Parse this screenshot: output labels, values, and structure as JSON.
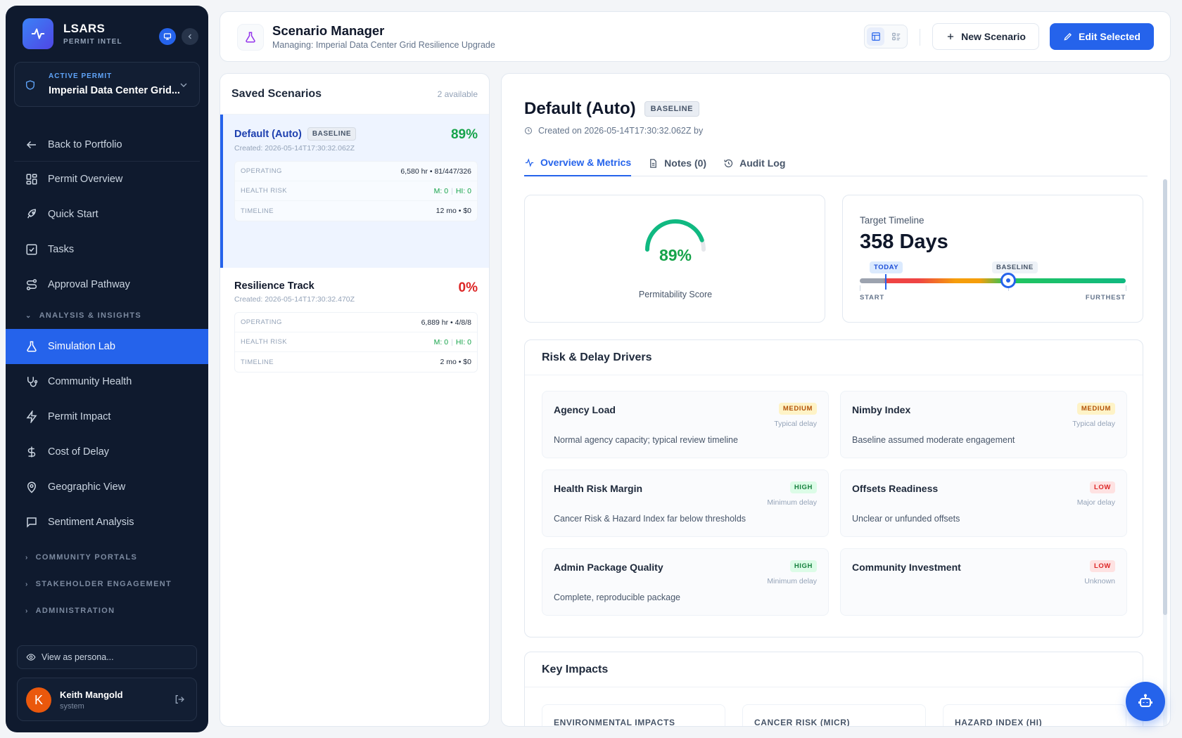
{
  "brand": {
    "name": "LSARS",
    "sub": "PERMIT INTEL"
  },
  "permit": {
    "label": "ACTIVE PERMIT",
    "name": "Imperial Data Center Grid..."
  },
  "nav": {
    "back": "Back to Portfolio",
    "items": [
      "Permit Overview",
      "Quick Start",
      "Tasks",
      "Approval Pathway"
    ],
    "section_analysis": "ANALYSIS & INSIGHTS",
    "analysis_items": [
      "Simulation Lab",
      "Community Health",
      "Permit Impact",
      "Cost of Delay",
      "Geographic View",
      "Sentiment Analysis"
    ],
    "section_portals": "COMMUNITY PORTALS",
    "section_stakeholder": "STAKEHOLDER ENGAGEMENT",
    "section_admin": "ADMINISTRATION"
  },
  "persona": {
    "label": "View as persona..."
  },
  "user": {
    "initial": "K",
    "name": "Keith Mangold",
    "role": "system"
  },
  "header": {
    "title": "Scenario Manager",
    "subtitle": "Managing: Imperial Data Center Grid Resilience Upgrade",
    "new_label": "New Scenario",
    "edit_label": "Edit Selected"
  },
  "saved": {
    "title": "Saved Scenarios",
    "count": "2 available",
    "scenarios": [
      {
        "name": "Default (Auto)",
        "badge": "BASELINE",
        "created": "Created: 2026-05-14T17:30:32.062Z",
        "pct": "89%",
        "operating_label": "OPERATING",
        "operating": "6,580 hr • 81/447/326",
        "health_label": "HEALTH RISK",
        "health_m": "M: 0",
        "health_hi": "HI: 0",
        "timeline_label": "TIMELINE",
        "timeline": "12 mo • $0"
      },
      {
        "name": "Resilience Track",
        "created": "Created: 2026-05-14T17:30:32.470Z",
        "pct": "0%",
        "operating_label": "OPERATING",
        "operating": "6,889 hr • 4/8/8",
        "health_label": "HEALTH RISK",
        "health_m": "M: 0",
        "health_hi": "HI: 0",
        "timeline_label": "TIMELINE",
        "timeline": "2 mo • $0"
      }
    ]
  },
  "detail": {
    "title": "Default (Auto)",
    "badge": "BASELINE",
    "created": "Created on 2026-05-14T17:30:32.062Z by",
    "tabs": [
      "Overview & Metrics",
      "Notes (0)",
      "Audit Log"
    ],
    "score": {
      "value": 0.89,
      "pct": "89%",
      "label": "Permitability Score"
    },
    "timeline": {
      "label": "Target Timeline",
      "value": "358 Days",
      "today": "TODAY",
      "baseline": "BASELINE",
      "start": "START",
      "end": "FURTHEST"
    },
    "risk_title": "Risk & Delay Drivers",
    "risks": [
      {
        "name": "Agency Load",
        "level": "MEDIUM",
        "impact": "Typical delay",
        "desc": "Normal agency capacity; typical review timeline"
      },
      {
        "name": "Nimby Index",
        "level": "MEDIUM",
        "impact": "Typical delay",
        "desc": "Baseline assumed moderate engagement"
      },
      {
        "name": "Health Risk Margin",
        "level": "HIGH",
        "impact": "Minimum delay",
        "desc": "Cancer Risk & Hazard Index far below thresholds"
      },
      {
        "name": "Offsets Readiness",
        "level": "LOW",
        "impact": "Major delay",
        "desc": "Unclear or unfunded offsets"
      },
      {
        "name": "Admin Package Quality",
        "level": "HIGH",
        "impact": "Minimum delay",
        "desc": "Complete, reproducible package"
      },
      {
        "name": "Community Investment",
        "level": "LOW",
        "impact": "Unknown",
        "desc": ""
      }
    ],
    "impacts_title": "Key Impacts",
    "impacts": [
      "ENVIRONMENTAL IMPACTS",
      "CANCER RISK (MICR)",
      "HAZARD INDEX (HI)"
    ]
  },
  "colors": {
    "accent": "#2563eb",
    "sidebar": "#0f1a2e",
    "good": "#16a34a",
    "bad": "#dc2626"
  }
}
